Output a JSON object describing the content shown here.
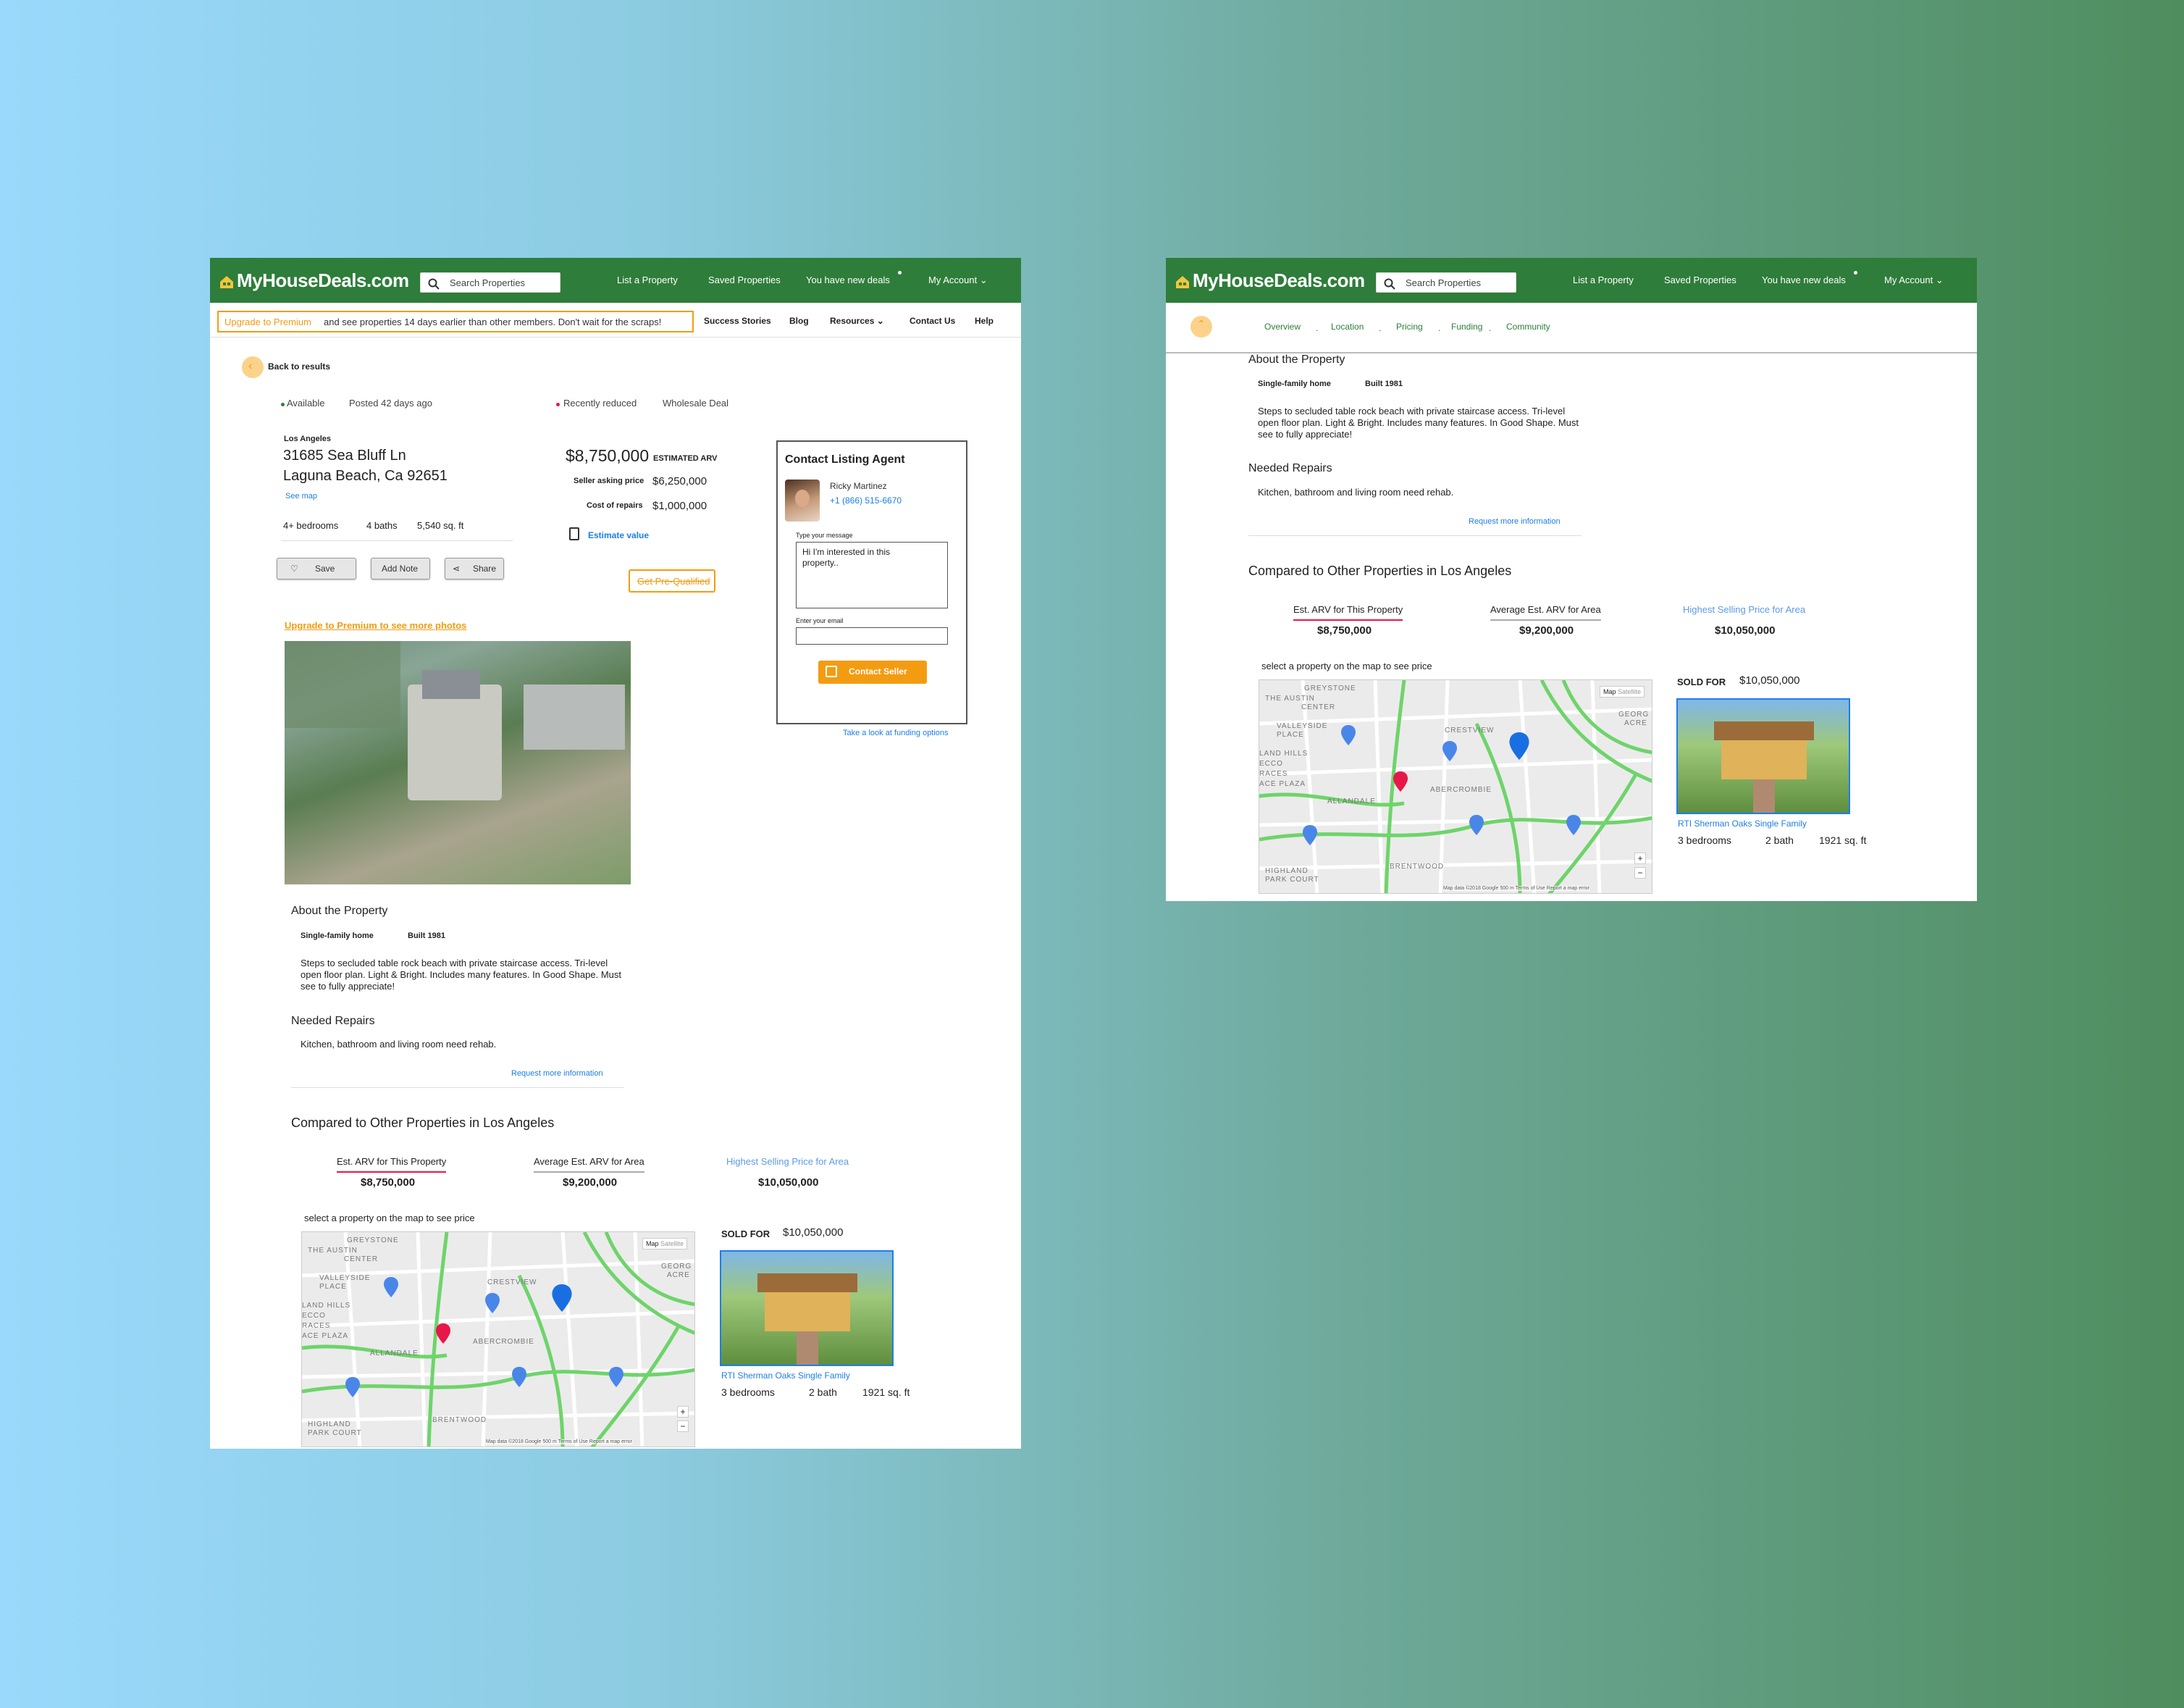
{
  "site": {
    "logo": "MyHouseDeals.com",
    "search_placeholder": "Search Properties",
    "nav": [
      "List a Property",
      "Saved Properties",
      "You have new deals",
      "My Account"
    ]
  },
  "subnav": {
    "upgrade_link": "Upgrade to Premium",
    "upgrade_text": "and see properties 14 days earlier than other members. Don't wait for the scraps!",
    "links": [
      "Success Stories",
      "Blog",
      "Resources",
      "Contact Us",
      "Help"
    ]
  },
  "section_tabs": [
    "Overview",
    "Location",
    "Pricing",
    "Funding",
    "Community"
  ],
  "back_link": "Back to results",
  "status": {
    "available": "Available",
    "posted": "Posted 42 days ago",
    "reduced": "Recently reduced",
    "deal_type": "Wholesale Deal"
  },
  "property": {
    "city": "Los Angeles",
    "street": "31685 Sea Bluff Ln",
    "city_line": "Laguna Beach, Ca  92651",
    "see_map": "See map",
    "bedrooms": "4+ bedrooms",
    "baths": "4 baths",
    "sqft": "5,540 sq. ft"
  },
  "pricing": {
    "arv": "$8,750,000",
    "arv_label": "ESTIMATED ARV",
    "asking_label": "Seller asking price",
    "asking": "$6,250,000",
    "repairs_label": "Cost of repairs",
    "repairs": "$1,000,000",
    "estimate_link": "Estimate value",
    "prequalified": "Get Pre-Qualified"
  },
  "actions": {
    "save": "Save",
    "note": "Add Note",
    "share": "Share"
  },
  "premium_photos": "Upgrade to Premium to see more photos",
  "contact": {
    "title": "Contact Listing Agent",
    "agent": "Ricky Martinez",
    "phone": "+1 (866) 515-6670",
    "message_label": "Type your message",
    "message_value": "Hi I'm interested in this property..",
    "email_label": "Enter your email",
    "button": "Contact Seller",
    "funding": "Take a look at funding options"
  },
  "about": {
    "heading": "About the Property",
    "type": "Single-family home",
    "built": "Built 1981",
    "description": "Steps to secluded table rock beach with private staircase access. Tri-level open floor plan. Light & Bright. Includes many features. In Good Shape. Must see to fully appreciate!",
    "repairs_heading": "Needed Repairs",
    "repairs_text": "Kitchen, bathroom and living room need rehab.",
    "request": "Request more information"
  },
  "compare": {
    "heading": "Compared to Other Properties in Los Angeles",
    "cols": [
      {
        "label": "Est. ARV for This Property",
        "value": "$8,750,000"
      },
      {
        "label": "Average Est. ARV for Area",
        "value": "$9,200,000"
      },
      {
        "label": "Highest Selling Price for Area",
        "value": "$10,050,000"
      }
    ],
    "map_hint": "select a property on the map to see price",
    "map_labels": [
      "GREYSTONE",
      "THE AUSTIN",
      "CENTER",
      "VALLEYSIDE",
      "PLACE",
      "LAND HILLS",
      "ECCO",
      "RACES",
      "ACE PLAZA",
      "CRESTVIEW",
      "ALLANDALE",
      "ABERCROMBIE",
      "HIGHLAND",
      "PARK COURT",
      "BRENTWOOD",
      "GEORG",
      "ACRE"
    ],
    "map_buttons": [
      "Map",
      "Satellite"
    ],
    "zoom": [
      "+",
      "−"
    ],
    "map_footer": "Map data ©2018 Google    500 m          Terms of Use    Report a map error",
    "sold_label": "SOLD FOR",
    "sold_value": "$10,050,000",
    "comp_name": "RTI Sherman Oaks Single Family",
    "comp_beds": "3 bedrooms",
    "comp_bath": "2 bath",
    "comp_sqft": "1921 sq. ft"
  },
  "colors": {
    "header": "#2e7d3a",
    "accent": "#f39c12",
    "link": "#1e7ee6",
    "pin_selected": "#e8174a",
    "pin": "#4a86e8"
  }
}
